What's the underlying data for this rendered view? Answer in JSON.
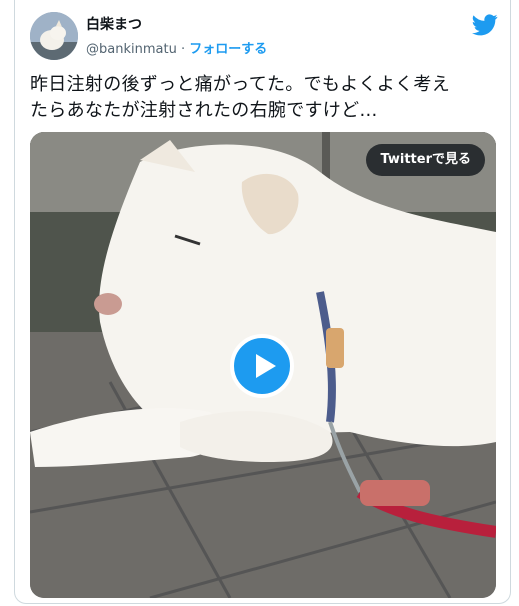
{
  "tweet": {
    "display_name": "白柴まつ",
    "handle": "@bankinmatu",
    "separator": " · ",
    "follow_label": "フォローする",
    "text_line1": "昨日注射の後ずっと痛がってた。でもよくよく考え",
    "text_line2": "たらあなたが注射されたの右腕ですけど…"
  },
  "media": {
    "watch_label": "Twitterで見る"
  },
  "colors": {
    "accent": "#1d9bf0",
    "text": "#0f1419",
    "secondary": "#536471"
  },
  "icons": {
    "brand": "twitter-bird-icon",
    "play": "play-icon"
  }
}
